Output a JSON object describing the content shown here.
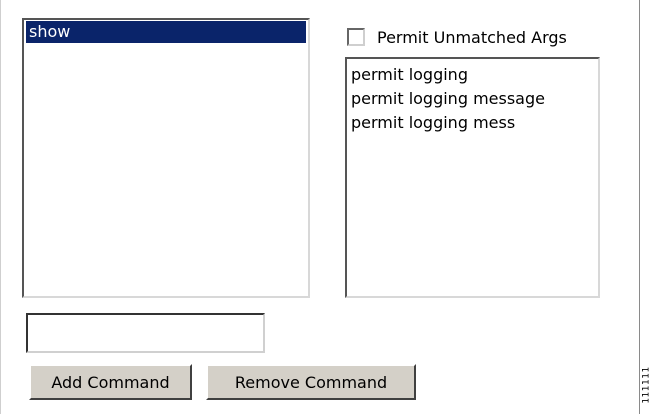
{
  "command_list": {
    "items": [
      {
        "label": "show",
        "selected": true
      }
    ]
  },
  "permit_unmatched": {
    "label": "Permit Unmatched Args",
    "checked": false
  },
  "arguments_list": {
    "items": [
      "permit logging",
      "permit logging message",
      "permit logging mess"
    ]
  },
  "command_input": {
    "value": "",
    "placeholder": ""
  },
  "buttons": {
    "add_label": "Add Command",
    "remove_label": "Remove Command"
  },
  "figure_id": "111111",
  "colors": {
    "selection_bg": "#0a246a",
    "button_face": "#d4d0c8"
  }
}
